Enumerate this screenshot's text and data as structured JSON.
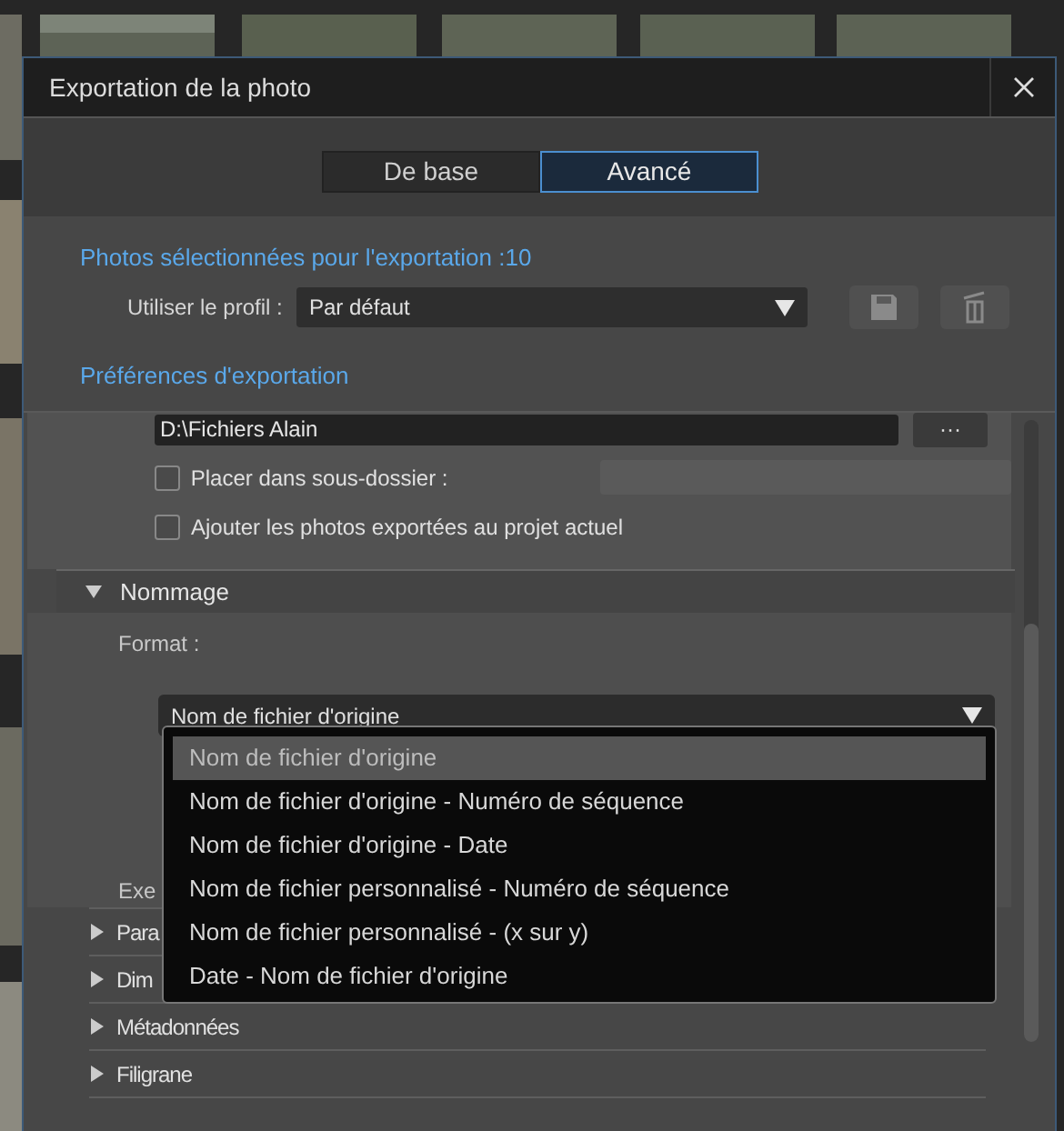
{
  "window": {
    "title": "Exportation de la photo"
  },
  "tabs": [
    {
      "label": "De base",
      "selected": false
    },
    {
      "label": "Avancé",
      "selected": true
    }
  ],
  "selection_heading": "Photos sélectionnées pour l'exportation :10",
  "profile": {
    "label": "Utiliser le profil :",
    "value": "Par défaut"
  },
  "preferences_heading": "Préférences d'exportation",
  "destination": {
    "folder": "D:\\Fichiers Alain",
    "browse": "···"
  },
  "options": [
    {
      "kind": "with_field",
      "label": "Placer dans sous-dossier :",
      "checked": false
    },
    {
      "kind": "plain",
      "label": "Ajouter les photos exportées au projet actuel",
      "checked": false
    }
  ],
  "naming": {
    "title": "Nommage",
    "expanded": true,
    "format_label": "Format :",
    "format_value": "Nom de fichier d'origine",
    "example_label": "Exe",
    "options": [
      {
        "label": "Nom de fichier d'origine",
        "selected": true
      },
      {
        "label": "Nom de fichier d'origine - Numéro de séquence",
        "selected": false
      },
      {
        "label": "Nom de fichier d'origine - Date",
        "selected": false
      },
      {
        "label": "Nom de fichier personnalisé - Numéro de séquence",
        "selected": false
      },
      {
        "label": "Nom de fichier personnalisé - (x sur y)",
        "selected": false
      },
      {
        "label": "Date - Nom de fichier d'origine",
        "selected": false
      }
    ]
  },
  "sections": [
    {
      "title": "Para",
      "expanded": false
    },
    {
      "title": "Dim",
      "expanded": false
    },
    {
      "title": "Métadonnées",
      "expanded": false
    },
    {
      "title": "Filigrane",
      "expanded": false
    }
  ]
}
